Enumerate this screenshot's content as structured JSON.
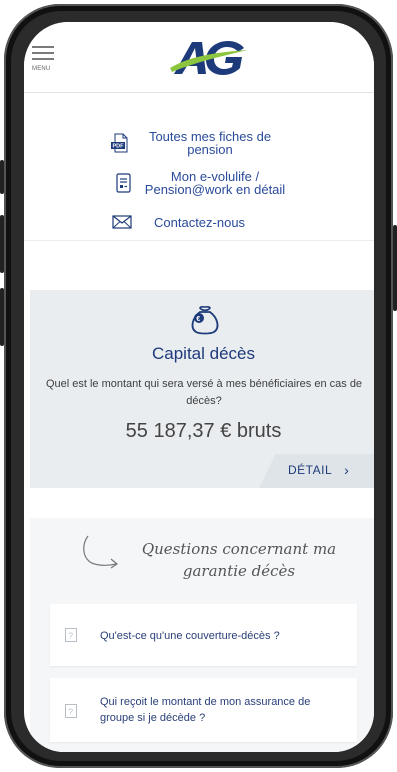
{
  "header": {
    "menu_label": "MENU",
    "logo_alt": "AG"
  },
  "links": [
    {
      "label": "Toutes mes fiches de pension",
      "icon": "pdf-icon"
    },
    {
      "label": "Mon e-volulife / Pension@work en détail",
      "icon": "document-icon"
    },
    {
      "label": "Contactez-nous",
      "icon": "envelope-icon"
    }
  ],
  "capital": {
    "title": "Capital décès",
    "question": "Quel est le montant qui sera versé à mes bénéficiaires en cas de décès?",
    "amount": "55 187,37 € bruts",
    "detail_label": "DÉTAIL",
    "icon": "money-bag-icon"
  },
  "faq": {
    "title": "Questions concernant ma garantie décès",
    "items": [
      {
        "label": "Qu'est-ce qu'une couverture-décès ?"
      },
      {
        "label": "Qui reçoit le montant de mon assurance de groupe si je décède ?"
      }
    ]
  },
  "colors": {
    "brand_blue": "#1d3a7a",
    "link_blue": "#2a4b9b",
    "logo_green": "#8cc63f",
    "card_bg": "#e9edf0"
  }
}
